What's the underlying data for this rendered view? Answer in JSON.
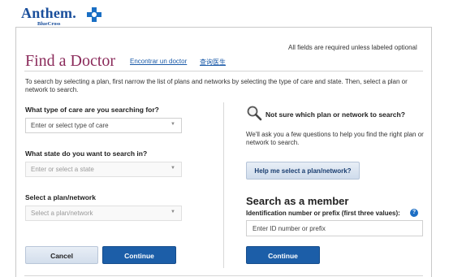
{
  "brand": {
    "logo_text": "Anthem.",
    "logo_sub": "BlueCross"
  },
  "required_note": "All fields are required unless labeled optional",
  "page": {
    "title": "Find a Doctor",
    "link_spanish": "Encontrar un doctor",
    "link_chinese": "查询医生",
    "intro": "To search by selecting a plan, first narrow the list of plans and networks by selecting the type of care and state. Then, select a plan or network to search."
  },
  "form": {
    "care_type": {
      "label": "What type of care are you searching for?",
      "value": "Enter or select type of care",
      "disabled": false
    },
    "state": {
      "label": "What state do you want to search in?",
      "value": "Enter or select a state",
      "disabled": true
    },
    "plan": {
      "label": "Select a plan/network",
      "value": "Select a plan/network",
      "disabled": true
    },
    "cancel_label": "Cancel",
    "continue_label": "Continue"
  },
  "help": {
    "question": "Not sure which plan or network to search?",
    "description": "We'll ask you a few questions to help you find the right plan or network to search.",
    "button_label": "Help me select a plan/network?"
  },
  "member": {
    "title": "Search as a member",
    "id_label": "Identification number or prefix (first three values):",
    "info_icon": "?",
    "input_placeholder": "Enter ID number or prefix",
    "continue_label": "Continue"
  },
  "colors": {
    "title": "#8a2a5a",
    "link": "#1a5aa8",
    "primary_button": "#1c5ea8",
    "brand": "#1a4f9c"
  }
}
